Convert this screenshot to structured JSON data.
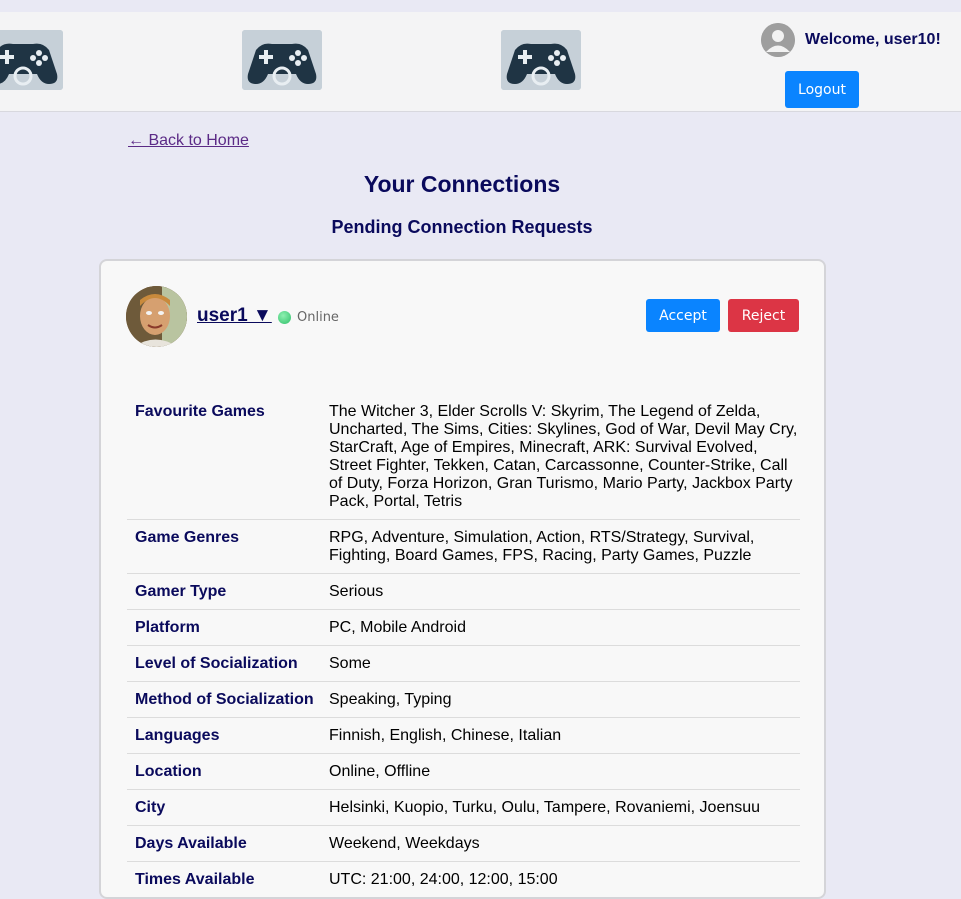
{
  "header": {
    "welcome": "Welcome, user10!",
    "logout_label": "Logout"
  },
  "nav": {
    "back_label": "← Back to Home"
  },
  "page": {
    "title": "Your Connections",
    "section_title": "Pending Connection Requests"
  },
  "request": {
    "username": "user1 ▼",
    "status": "Online",
    "accept_label": "Accept",
    "reject_label": "Reject",
    "status_color": "#2fbf6a",
    "accept_color": "#0a84ff",
    "reject_color": "#dc3545"
  },
  "details": [
    {
      "label": "Favourite Games",
      "value": "The Witcher 3, Elder Scrolls V: Skyrim, The Legend of Zelda, Uncharted, The Sims, Cities: Skylines, God of War, Devil May Cry, StarCraft, Age of Empires, Minecraft, ARK: Survival Evolved, Street Fighter, Tekken, Catan, Carcassonne, Counter-Strike, Call of Duty, Forza Horizon, Gran Turismo, Mario Party, Jackbox Party Pack, Portal, Tetris"
    },
    {
      "label": "Game Genres",
      "value": "RPG, Adventure, Simulation, Action, RTS/Strategy, Survival, Fighting, Board Games, FPS, Racing, Party Games, Puzzle"
    },
    {
      "label": "Gamer Type",
      "value": "Serious"
    },
    {
      "label": "Platform",
      "value": "PC, Mobile Android"
    },
    {
      "label": "Level of Socialization",
      "value": "Some"
    },
    {
      "label": "Method of Socialization",
      "value": "Speaking, Typing"
    },
    {
      "label": "Languages",
      "value": "Finnish, English, Chinese, Italian"
    },
    {
      "label": "Location",
      "value": "Online, Offline"
    },
    {
      "label": "City",
      "value": "Helsinki, Kuopio, Turku, Oulu, Tampere, Rovaniemi, Joensuu"
    },
    {
      "label": "Days Available",
      "value": "Weekend, Weekdays"
    },
    {
      "label": "Times Available",
      "value": "UTC: 21:00, 24:00, 12:00, 15:00"
    }
  ]
}
